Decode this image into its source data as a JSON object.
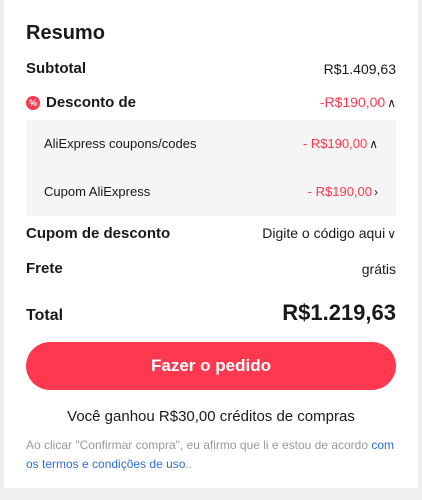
{
  "summary": {
    "title": "Resumo",
    "subtotal": {
      "label": "Subtotal",
      "value": "R$1.409,63"
    },
    "discount": {
      "label": "Desconto de",
      "value": "-R$190,00",
      "icon": "discount-icon",
      "items": [
        {
          "label": "AliExpress coupons/codes",
          "value": "- R$190,00"
        },
        {
          "label": "Cupom AliExpress",
          "value": "- R$190,00"
        }
      ]
    },
    "coupon": {
      "label": "Cupom de desconto",
      "value": "Digite o código aqui"
    },
    "shipping": {
      "label": "Frete",
      "value": "grátis"
    },
    "total": {
      "label": "Total",
      "value": "R$1.219,63"
    },
    "order_button": "Fazer o pedido",
    "credits_text": "Você ganhou R$30,00 créditos de compras",
    "terms_prefix": "Ao clicar \"Confirmar compra\", eu afirmo que li e estou de acordo ",
    "terms_link": "com os termos e condições de uso",
    "terms_suffix": ".."
  },
  "colors": {
    "accent": "#fd384f",
    "link": "#2e6fd1",
    "muted": "#999999",
    "subbox": "#f5f5f5"
  }
}
